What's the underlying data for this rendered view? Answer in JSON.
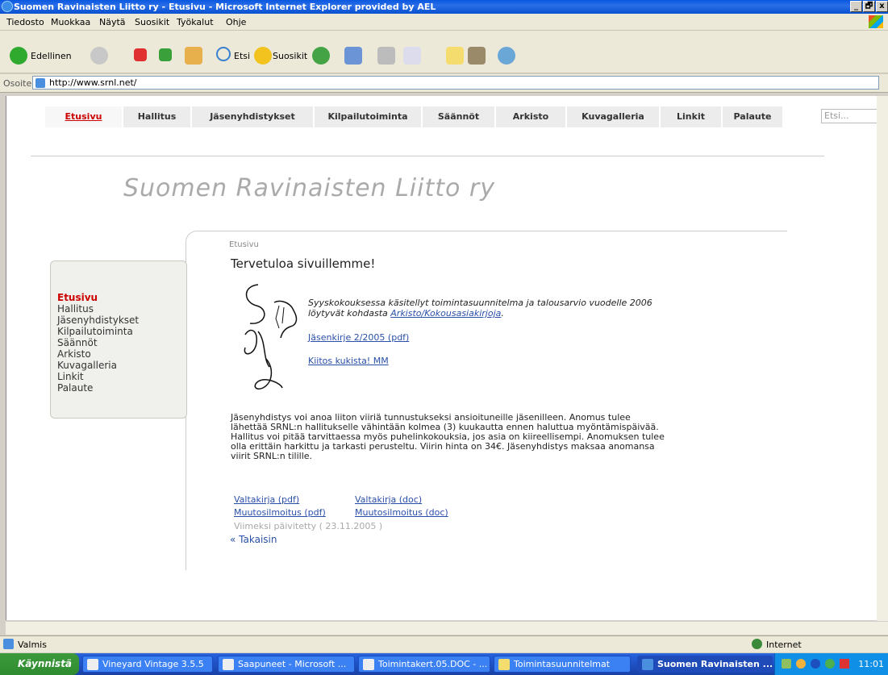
{
  "window": {
    "title": "Suomen Ravinaisten Liitto ry - Etusivu - Microsoft Internet Explorer provided by AEL",
    "min": "_",
    "max": "🗗",
    "close": "x"
  },
  "menu": [
    "Tiedosto",
    "Muokkaa",
    "Näytä",
    "Suosikit",
    "Työkalut",
    "Ohje"
  ],
  "toolbar": {
    "back_label": "Edellinen",
    "search_label": "Etsi",
    "favorites_label": "Suosikit"
  },
  "address": {
    "label": "Osoite",
    "url": "http://www.srnl.net/"
  },
  "site": {
    "tabs": [
      "Etusivu",
      "Hallitus",
      "Jäsenyhdistykset",
      "Kilpailutoiminta",
      "Säännöt",
      "Arkisto",
      "Kuvagalleria",
      "Linkit",
      "Palaute"
    ],
    "search_placeholder": "Etsi...",
    "title": "Suomen Ravinaisten Liitto ry",
    "sidebar": [
      "Etusivu",
      "Hallitus",
      "Jäsenyhdistykset",
      "Kilpailutoiminta",
      "Säännöt",
      "Arkisto",
      "Kuvagalleria",
      "Linkit",
      "Palaute"
    ],
    "breadcrumb": "Etusivu",
    "heading": "Tervetuloa sivuillemme!",
    "intro_text": "Syyskokouksessa käsitellyt toimintasuunnitelma ja talousarvio vuodelle 2006 löytyvät kohdasta",
    "intro_link": "Arkisto/Kokousasiakirjoja",
    "intro_end": ".",
    "link_jasenkirje": "Jäsenkirje 2/2005 (pdf)",
    "link_kiitos": "Kiitos kukista! MM",
    "body": "Jäsenyhdistys voi anoa liiton viiriä tunnustukseksi ansioituneille jäsenilleen. Anomus tulee lähettää SRNL:n hallitukselle vähintään kolmea (3) kuukautta ennen haluttua myöntämispäivää. Hallitus voi pitää tarvittaessa myös puhelinkokouksia, jos asia on kiireellisempi. Anomuksen tulee olla erittäin harkittu ja tarkasti perusteltu. Viirin hinta on 34€. Jäsenyhdistys maksaa anomansa viirit SRNL:n tilille.",
    "downloads": [
      "Valtakirja (pdf)",
      "Valtakirja (doc)",
      "Muutosilmoitus (pdf)",
      "Muutosilmoitus (doc)"
    ],
    "updated": "Viimeksi päivitetty ( 23.11.2005 )",
    "back": "« Takaisin"
  },
  "status": {
    "text": "Valmis",
    "zone": "Internet"
  },
  "taskbar": {
    "start": "Käynnistä",
    "tasks": [
      "Vineyard Vintage 3.5.5",
      "Saapuneet - Microsoft ...",
      "Toimintakert.05.DOC - ...",
      "Toimintasuunnitelmat",
      "Suomen Ravinaisten ..."
    ],
    "clock": "11:01"
  },
  "colors": {
    "active_tab": "#cc0000",
    "link": "#2a4fa8",
    "title_gray": "#aaaaaa"
  }
}
